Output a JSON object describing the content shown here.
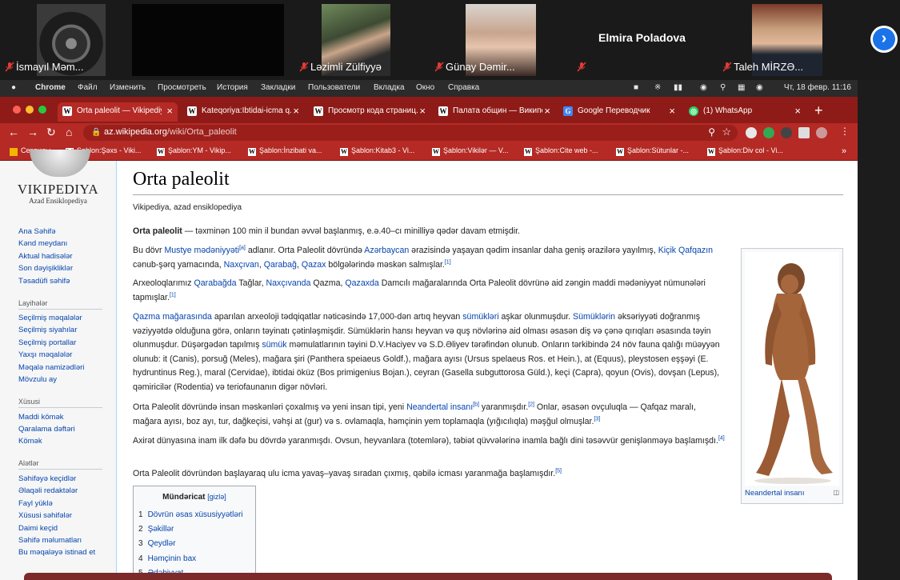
{
  "call": {
    "participants": [
      {
        "name": "İsmayıl Məm...",
        "video": "dark-portal"
      },
      {
        "name": "",
        "video": "black"
      },
      {
        "name": "Ləzimli Zülfiyyə",
        "video": "woman-scarf"
      },
      {
        "name": "Günay Dəmir...",
        "video": "woman"
      },
      {
        "name": "Elmira Poladova",
        "video": "none"
      },
      {
        "name": "Taleh MİRZƏ...",
        "video": "man-suit"
      }
    ],
    "next_label": "›"
  },
  "menubar": {
    "apple": "",
    "app": "Chrome",
    "items": [
      "Файл",
      "Изменить",
      "Просмотреть",
      "История",
      "Закладки",
      "Пользователи",
      "Вкладка",
      "Окно",
      "Справка"
    ],
    "clock": "Чт, 18 февр.  11:16"
  },
  "tabs": [
    {
      "favicon": "W",
      "title": "Orta paleolit — Vikipediya",
      "active": true
    },
    {
      "favicon": "W",
      "title": "Kateqoriya:İbtidai-icma q...",
      "active": false
    },
    {
      "favicon": "W",
      "title": "Просмотр кода страниц...",
      "active": false
    },
    {
      "favicon": "W",
      "title": "Палата общин — Википе...",
      "active": false
    },
    {
      "favicon": "G",
      "title": "Google Переводчик",
      "active": false
    },
    {
      "favicon": "◎",
      "title": "(1) WhatsApp",
      "active": false
    }
  ],
  "new_tab": "+",
  "address": {
    "host": "az.wikipedia.org",
    "path": "/wiki/Orta_paleolit"
  },
  "bookmarks": [
    "Сервисы",
    "Şablon:Şəxs - Viki...",
    "Şablon:YM - Vikip...",
    "Şablon:İnzibati va...",
    "Şablon:Kitab3 - Vi...",
    "Şablon:Vikilər — V...",
    "Şablon:Cite web -...",
    "Şablon:Sütunlar -...",
    "Şablon:Div col - Vi..."
  ],
  "wiki": {
    "wordmark": "VIKIPEDIYA",
    "tagline": "Azad Ensiklopediya",
    "nav": [
      "Ana Səhifə",
      "Kənd meydanı",
      "Aktual hadisələr",
      "Son dəyişikliklər",
      "Təsadüfi səhifə"
    ],
    "section_layihe": "Layihələr",
    "layihe": [
      "Seçilmiş məqalələr",
      "Seçilmiş siyahılar",
      "Seçilmiş portallar",
      "Yaxşı məqalələr",
      "Məqalə namizədləri",
      "Mövzulu ay"
    ],
    "section_xususi": "Xüsusi",
    "xususi": [
      "Maddi kömək",
      "Qaralama dəftəri",
      "Kömək"
    ],
    "section_aletler": "Alətlər",
    "aletler": [
      "Səhifəyə keçidlər",
      "Əlaqəli redaktələr",
      "Fayl yüklə",
      "Xüsusi səhifələr",
      "Daimi keçid",
      "Səhifə məlumatları",
      "Bu məqaləyə istinad et"
    ]
  },
  "article": {
    "title": "Orta paleolit",
    "subtitle": "Vikipediya, azad ensiklopediya",
    "p1_bold": "Orta paleolit",
    "p1": " — təxminən 100 min il bundan əvvəl başlanmış, e.ə.40–cı minilliyə qədər davam etmişdir.",
    "p2_a": "Bu dövr ",
    "p2_link1": "Mustye mədəniyyəti",
    "p2_sup1": "[a]",
    "p2_b": " adlanır. Orta Paleolit dövründə ",
    "p2_link2": "Azərbaycan",
    "p2_c": " ərazisində yaşayan qədim insanlar daha geniş ərazilərə yayılmış, ",
    "p2_link3": "Kiçik Qafqazın",
    "p2_d": " cənub-şərq yamacında, ",
    "p2_link4": "Naxçıvan",
    "p2_e": ", ",
    "p2_link5": "Qarabağ",
    "p2_f": ", ",
    "p2_link6": "Qazax",
    "p2_g": " bölgələrində məskən salmışlar.",
    "p2_sup2": "[1]",
    "p3_a": "Arxeoloqlarımız ",
    "p3_link1": "Qarabağda",
    "p3_b": " Tağlar, ",
    "p3_link2": "Naxçıvanda",
    "p3_c": " Qazma, ",
    "p3_link3": "Qazaxda",
    "p3_d": " Damcılı mağaralarında Orta Paleolit dövrünə aid zəngin maddi mədəniyyət nümunələri tapmışlar.",
    "p3_sup": "[1]",
    "p4_link1": "Qazma mağarasında",
    "p4_a": " aparılan arxeoloji tədqiqatlar nəticəsində 17,000-dən artıq heyvan ",
    "p4_link2": "sümükləri",
    "p4_b": " aşkar olunmuşdur. ",
    "p4_link3": "Sümüklərin",
    "p4_c": " əksəriyyəti doğranmış vəziyyətdə olduğuna görə, onların təyinatı çətinləşmişdir. Sümüklərin hansı heyvan və quş növlərinə aid olması əsasən diş və çənə qırıqları əsasında təyin olunmuşdur. Düşərgədən tapılmış ",
    "p4_link4": "sümük",
    "p4_d": " məmulatlarının təyini D.V.Haciyev və S.D.Əliyev tərəfindən olunub. Onların tərkibində 24 növ fauna qalığı müəyyən olunub: it (Canis), porsuğ (Meles), mağara şiri (Panthera speiaeus Goldf.), mağara ayısı (Ursus spelaeus Ros. et Hein.), at (Equus), pleystosen eşşəyi (E. hydruntinus Reg.), maral (Cervidae), ibtidai öküz (Bos primigenius Bojan.), ceyran (Gasella subguttorosa Güld.), keçi (Capra), qoyun (Ovis), dovşan (Lepus), qəmiricilər (Rodentia) və teriofaunanın digər növləri.",
    "p5_a": "Orta Paleolit dövründə insan məskənləri çoxalmış və yeni insan tipi, yeni ",
    "p5_link1": "Neandertal insanı",
    "p5_sup1": "[b]",
    "p5_b": " yaranmışdır.",
    "p5_sup2": "[2]",
    "p5_c": " Onlar, əsasən ovçuluqla — Qafqaz maralı, mağara ayısı, boz ayı, tur, dağkeçisi, vəhşi at (gur) və s. ovlamaqla, həmçinin yem toplamaqla (yığıcılıqla) məşğul olmuşlar.",
    "p5_sup3": "[3]",
    "p6": "Axirət dünyasına inam ilk dəfə bu dövrdə yaranmışdı. Ovsun, heyvanlara (totemlərə), təbiət qüvvələrinə inamla bağlı dini təsəvvür genişlənməyə başlamışdı.",
    "p6_sup": "[4]",
    "p7": "Orta Paleolit dövründən başlayaraq ulu icma yavaş–yavaş sıradan çıxmış, qəbilə icması yaranmağa başlamışdır.",
    "p7_sup": "[5]"
  },
  "infobox": {
    "caption": "Neandertal insanı",
    "image": "neanderthal-illustration"
  },
  "toc": {
    "title": "Mündəricat",
    "hide": "[gizlə]",
    "items": [
      {
        "n": "1",
        "label": "Dövrün əsas xüsusiyyətləri"
      },
      {
        "n": "2",
        "label": "Şəkillər"
      },
      {
        "n": "3",
        "label": "Qeydlər"
      },
      {
        "n": "4",
        "label": "Həmçinin bax"
      },
      {
        "n": "5",
        "label": "Ədəbiyyat"
      }
    ]
  },
  "colors": {
    "chrome_theme": "#b52a25",
    "tab_bar": "#8e1b17",
    "wiki_link": "#0645ad"
  }
}
